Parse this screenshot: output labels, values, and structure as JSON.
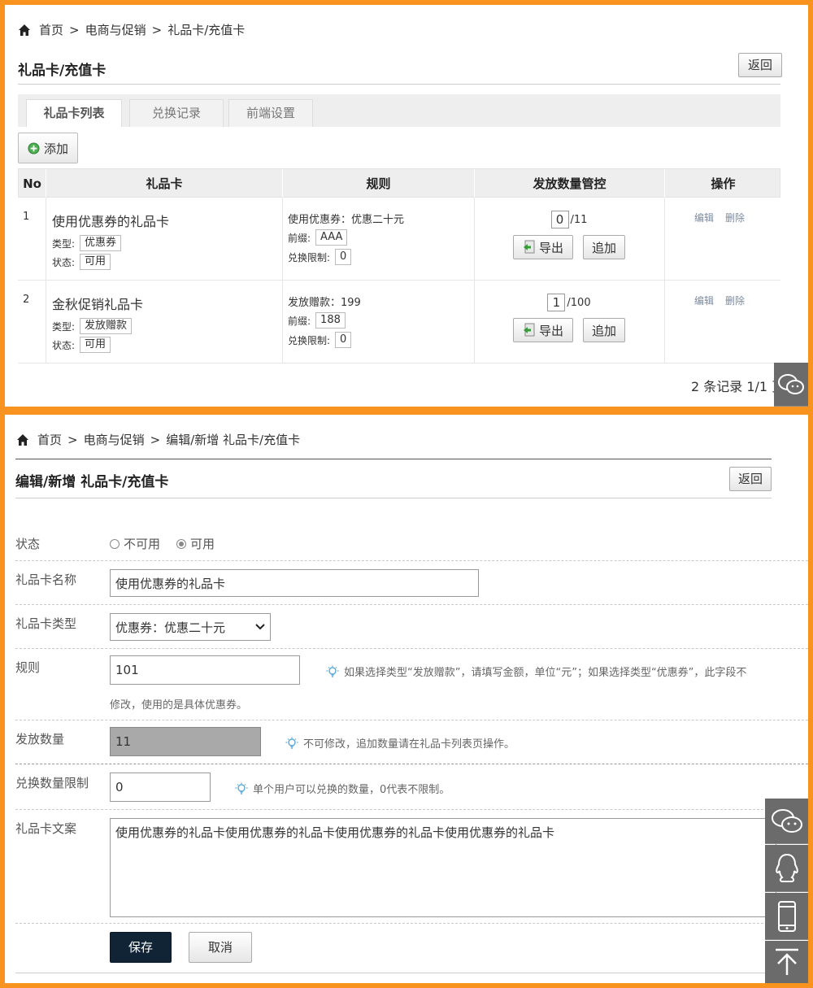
{
  "list": {
    "breadcrumb": [
      "首页",
      "电商与促销",
      "礼品卡/充值卡"
    ],
    "breadcrumb_sep": ">",
    "title": "礼品卡/充值卡",
    "back_label": "返回",
    "tabs": [
      {
        "label": "礼品卡列表",
        "active": true
      },
      {
        "label": "兑换记录",
        "active": false
      },
      {
        "label": "前端设置",
        "active": false
      }
    ],
    "add_label": "添加",
    "columns": [
      "No",
      "礼品卡",
      "规则",
      "发放数量管控",
      "操作"
    ],
    "rows": [
      {
        "no": "1",
        "name": "使用优惠券的礼品卡",
        "type_label": "类型:",
        "type": "优惠券",
        "status_label": "状态:",
        "status": "可用",
        "rule_text": "使用优惠券：优惠二十元",
        "prefix_label": "前缀:",
        "prefix": "AAA",
        "limit_label": "兑换限制:",
        "limit": "0",
        "issued": "0",
        "total": "/11",
        "export_label": "导出",
        "append_label": "追加",
        "edit_label": "编辑",
        "delete_label": "删除"
      },
      {
        "no": "2",
        "name": "金秋促销礼品卡",
        "type_label": "类型:",
        "type": "发放赠款",
        "status_label": "状态:",
        "status": "可用",
        "rule_text": "发放赠款：199",
        "prefix_label": "前缀:",
        "prefix": "188",
        "limit_label": "兑换限制:",
        "limit": "0",
        "issued": "1",
        "total": "/100",
        "export_label": "导出",
        "append_label": "追加",
        "edit_label": "编辑",
        "delete_label": "删除"
      }
    ],
    "pager": "2 条记录 1/1 页"
  },
  "form": {
    "breadcrumb": [
      "首页",
      "电商与促销",
      "编辑/新增 礼品卡/充值卡"
    ],
    "breadcrumb_sep": ">",
    "title": "编辑/新增 礼品卡/充值卡",
    "back_label": "返回",
    "status_label": "状态",
    "status_options": [
      "不可用",
      "可用"
    ],
    "status_selected": "可用",
    "name_label": "礼品卡名称",
    "name_value": "使用优惠券的礼品卡",
    "type_label": "礼品卡类型",
    "type_value": "优惠券：优惠二十元",
    "rule_label": "规则",
    "rule_value": "101",
    "rule_hint": "如果选择类型“发放赠款”，请填写金额，单位“元”；如果选择类型“优惠券”，此字段不",
    "rule_hint_cont": "修改，使用的是具体优惠券。",
    "issue_label": "发放数量",
    "issue_value": "11",
    "issue_hint": "不可修改，追加数量请在礼品卡列表页操作。",
    "limit_label": "兑换数量限制",
    "limit_value": "0",
    "limit_hint": "单个用户可以兑换的数量，0代表不限制。",
    "copy_label": "礼品卡文案",
    "copy_value": "使用优惠券的礼品卡使用优惠券的礼品卡使用优惠券的礼品卡使用优惠券的礼品卡",
    "save_label": "保存",
    "cancel_label": "取消"
  },
  "side_icons": [
    "wechat-icon",
    "qq-icon",
    "mobile-icon",
    "back-to-top-icon"
  ]
}
